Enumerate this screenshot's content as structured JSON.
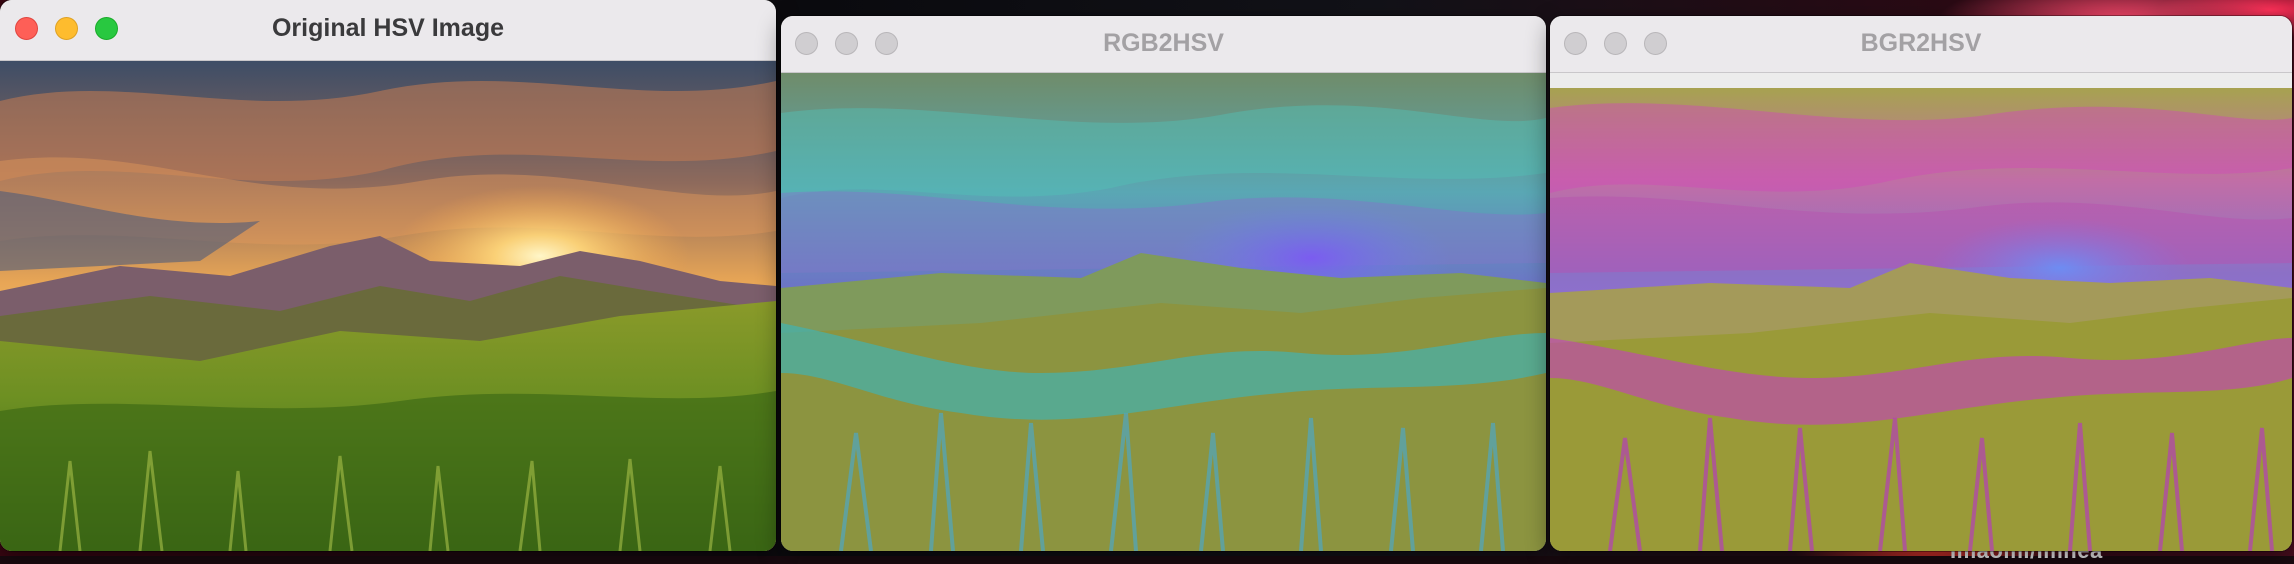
{
  "windows": [
    {
      "title": "Original HSV Image",
      "state": "active",
      "image": "mountain-sunset-photo"
    },
    {
      "title": "RGB2HSV",
      "state": "inactive",
      "image": "mountain-sunset-rgb2hsv"
    },
    {
      "title": "BGR2HSV",
      "state": "inactive",
      "image": "mountain-sunset-bgr2hsv"
    }
  ],
  "desktop": {
    "partial_label": "Imaoml/Imnea"
  },
  "colors": {
    "titlebar": "#ebe9ec",
    "active_title_text": "#3a3a3c",
    "inactive_title_text": "#a3a1a4",
    "close": "#fe5f57",
    "minimize": "#febc2e",
    "maximize": "#28c840"
  }
}
